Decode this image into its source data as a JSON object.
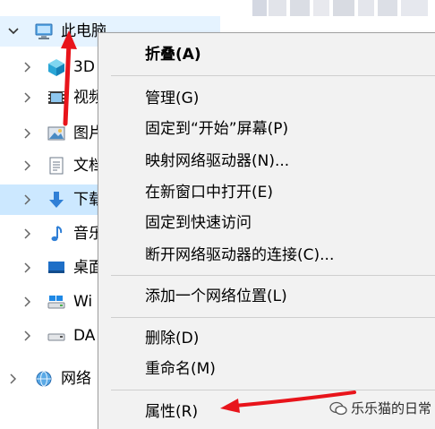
{
  "tree": {
    "this_pc": "此电脑",
    "items": [
      {
        "label": "3D",
        "icon": "3d-objects-icon"
      },
      {
        "label": "视频",
        "icon": "videos-icon"
      },
      {
        "label": "图片",
        "icon": "pictures-icon"
      },
      {
        "label": "文档",
        "icon": "documents-icon"
      },
      {
        "label": "下载",
        "icon": "downloads-icon"
      },
      {
        "label": "音乐",
        "icon": "music-icon"
      },
      {
        "label": "桌面",
        "icon": "desktop-icon"
      },
      {
        "label": "Wi",
        "icon": "drive-icon"
      },
      {
        "label": "DA",
        "icon": "drive-icon"
      }
    ],
    "network": "网络"
  },
  "menu": {
    "collapse": "折叠(A)",
    "manage": "管理(G)",
    "pin_start": "固定到“开始”屏幕(P)",
    "map_drive": "映射网络驱动器(N)...",
    "open_new_window": "在新窗口中打开(E)",
    "pin_quick": "固定到快速访问",
    "disconnect_drive": "断开网络驱动器的连接(C)...",
    "add_network_location": "添加一个网络位置(L)",
    "delete": "删除(D)",
    "rename": "重命名(M)",
    "properties": "属性(R)"
  },
  "watermark": "乐乐猫的日常",
  "colors": {
    "selected": "#cce8ff",
    "hover": "#e5f3ff",
    "menu_bg": "#f2f2f2",
    "arrow": "#e8141b"
  }
}
